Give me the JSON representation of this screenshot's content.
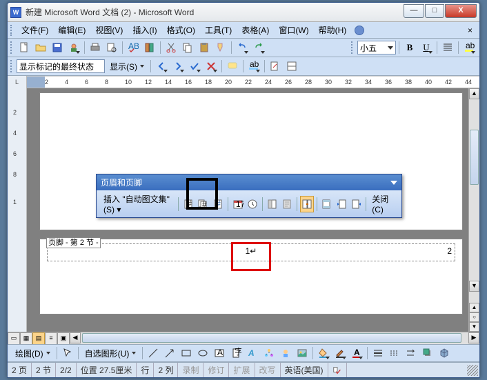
{
  "title": "新建 Microsoft Word 文档 (2) - Microsoft Word",
  "app_icon_letter": "W",
  "menus": {
    "file": "文件(F)",
    "edit": "编辑(E)",
    "view": "视图(V)",
    "insert": "插入(I)",
    "format": "格式(O)",
    "tools": "工具(T)",
    "table": "表格(A)",
    "window": "窗口(W)",
    "help": "帮助(H)"
  },
  "font_size": "小五",
  "format_bold": "B",
  "format_underline": "U",
  "track_state": "显示标记的最终状态",
  "show_label": "显示(S)",
  "ruler": {
    "start": 2,
    "end": 44,
    "step": 2
  },
  "hf_toolbar": {
    "title": "页眉和页脚",
    "insert_autotext": "插入 \"自动图文集\" (S)",
    "close": "关闭(C)"
  },
  "footer": {
    "label": "页脚 - 第 2 节 -",
    "center": "1↵",
    "right": "2"
  },
  "draw": {
    "label": "绘图(D)",
    "autoshape": "自选图形(U)"
  },
  "status": {
    "page": "2 页",
    "section": "2 节",
    "pages": "2/2",
    "position": "位置 27.5厘米",
    "line": "行",
    "col": "2 列",
    "rec": "录制",
    "trk": "修订",
    "ext": "扩展",
    "ovr": "改写",
    "lang": "英语(美国)"
  }
}
